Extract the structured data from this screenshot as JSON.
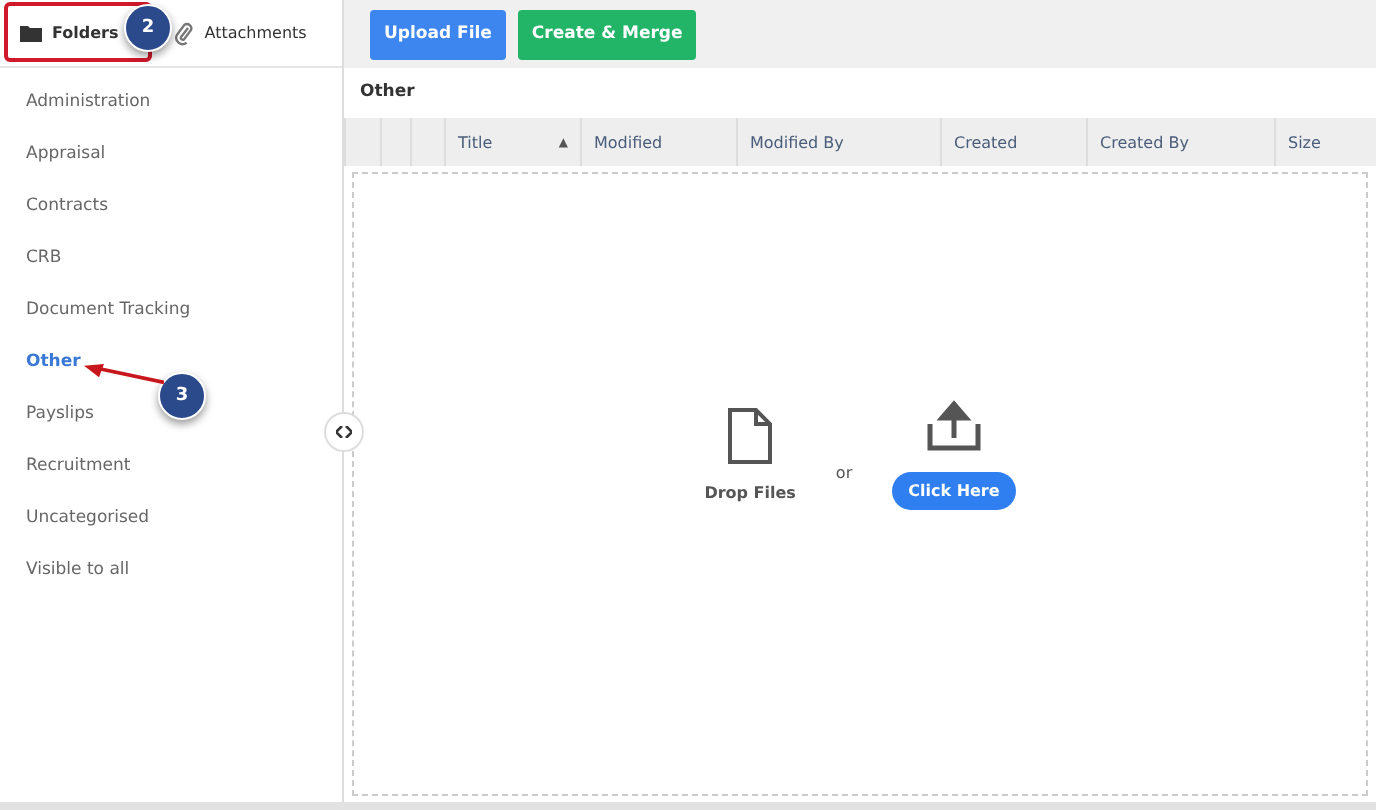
{
  "tabs": [
    {
      "label": "Folders",
      "selected": true
    },
    {
      "label": "Attachments",
      "selected": false
    }
  ],
  "folders": [
    {
      "label": "Administration",
      "selected": false
    },
    {
      "label": "Appraisal",
      "selected": false
    },
    {
      "label": "Contracts",
      "selected": false
    },
    {
      "label": "CRB",
      "selected": false
    },
    {
      "label": "Document Tracking",
      "selected": false
    },
    {
      "label": "Other",
      "selected": true
    },
    {
      "label": "Payslips",
      "selected": false
    },
    {
      "label": "Recruitment",
      "selected": false
    },
    {
      "label": "Uncategorised",
      "selected": false
    },
    {
      "label": "Visible to all",
      "selected": false
    }
  ],
  "toolbar": [
    {
      "label": "Upload File",
      "kind": "primary"
    },
    {
      "label": "Create & Merge",
      "kind": "success"
    }
  ],
  "folder_title": "Other",
  "table": {
    "columns": [
      {
        "label": "Title",
        "sorted": true
      },
      {
        "label": "Modified",
        "sorted": false
      },
      {
        "label": "Modified By",
        "sorted": false
      },
      {
        "label": "Created",
        "sorted": false
      },
      {
        "label": "Created By",
        "sorted": false
      },
      {
        "label": "Size",
        "sorted": false
      }
    ],
    "sort_glyph": "▲"
  },
  "dropzone": {
    "drop_label": "Drop Files",
    "or": "or",
    "button": "Click Here"
  },
  "annotations": [
    {
      "label": "2"
    },
    {
      "label": "3"
    }
  ]
}
